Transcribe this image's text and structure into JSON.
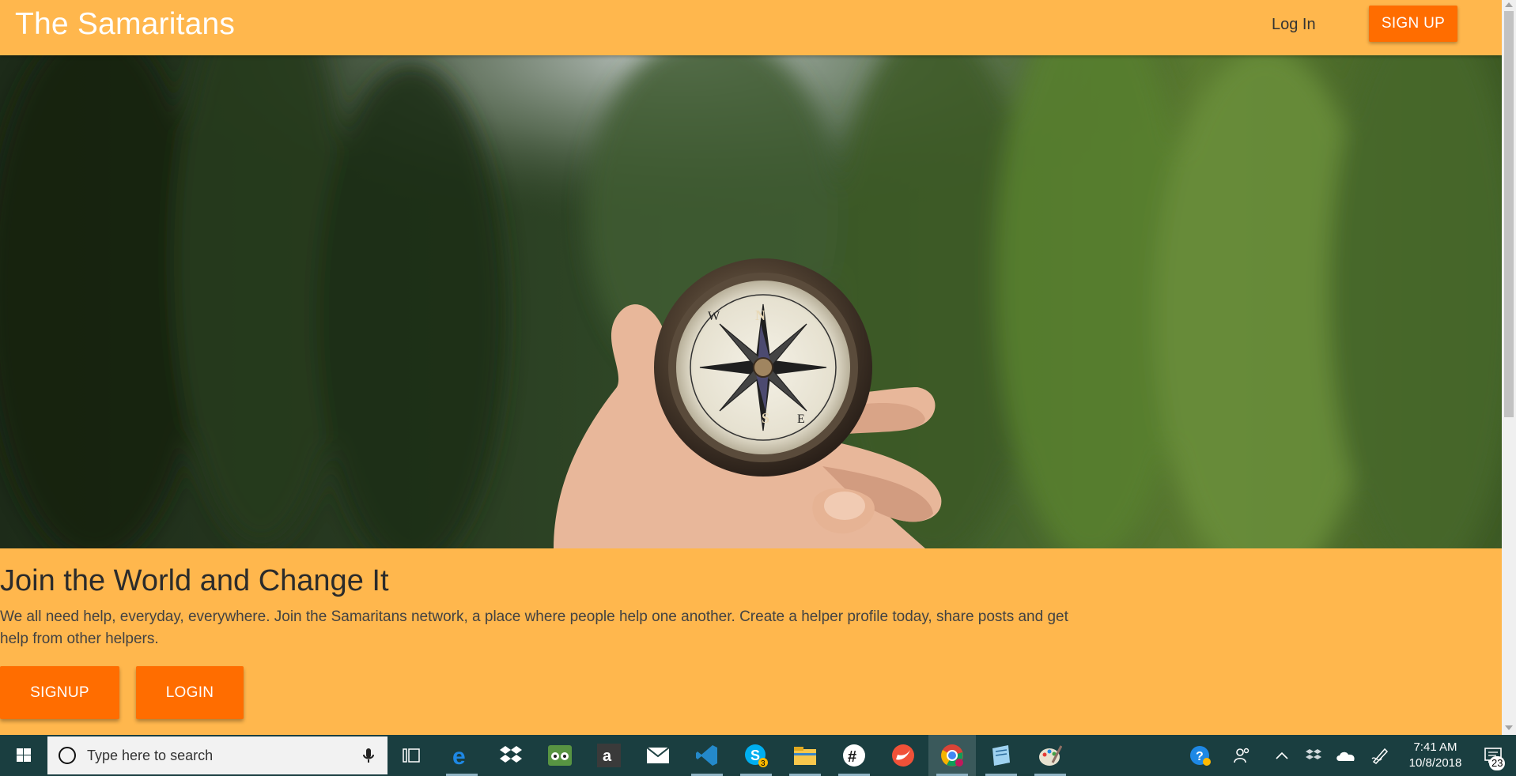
{
  "navbar": {
    "brand": "The Samaritans",
    "login_label": "Log In",
    "signup_label": "SIGN UP"
  },
  "hero": {
    "compass_letters": [
      "N",
      "S",
      "E",
      "W"
    ]
  },
  "content": {
    "heading": "Join the World and Change It",
    "description": "We all need help, everyday, everywhere. Join the Samaritans network, a place where people help one another. Create a helper profile today, share posts and get help from other helpers.",
    "signup_button": "SIGNUP",
    "login_button": "LOGIN"
  },
  "taskbar": {
    "search_placeholder": "Type here to search",
    "apps": [
      "task-view",
      "edge",
      "dropbox",
      "tripadvisor",
      "amazon",
      "mail",
      "vscode",
      "skype",
      "file-explorer",
      "slack",
      "swift",
      "chrome",
      "notepad",
      "paint"
    ],
    "skype_badge": "3",
    "clock_time": "7:41 AM",
    "clock_date": "10/8/2018",
    "notification_count": "23"
  },
  "colors": {
    "brand_background": "#ffb74d",
    "accent_button": "#ff6d00",
    "taskbar": "#1a3e40"
  }
}
